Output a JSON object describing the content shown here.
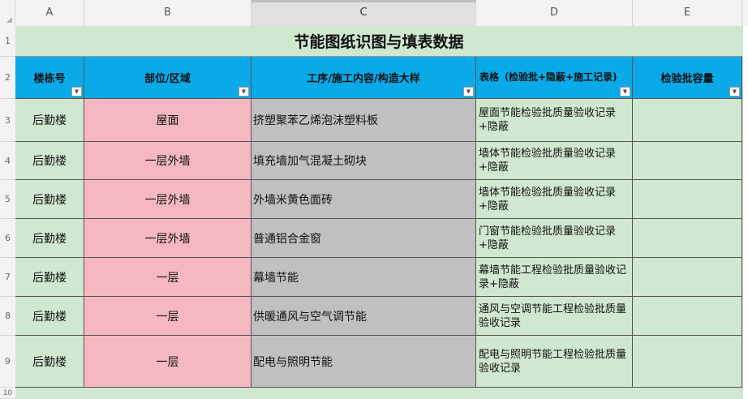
{
  "column_headers": [
    "A",
    "B",
    "C",
    "D",
    "E"
  ],
  "row_numbers": [
    "1",
    "2",
    "3",
    "4",
    "5",
    "6",
    "7",
    "8",
    "9",
    "10"
  ],
  "title": "节能图纸识图与填表数据",
  "headers": {
    "building": "楼栋号",
    "location": "部位/区域",
    "process": "工序/施工内容/构造大样",
    "form": "表格（检验批+隐蔽+施工记录)",
    "capacity": "检验批容量"
  },
  "filter_icon": "chevron-down-icon",
  "rows": [
    {
      "building": "后勤楼",
      "location": "屋面",
      "process": "挤塑聚苯乙烯泡沫塑料板",
      "form": "屋面节能检验批质量验收记录+隐蔽",
      "capacity": ""
    },
    {
      "building": "后勤楼",
      "location": "一层外墙",
      "process": "填充墙加气混凝土砌块",
      "form": "墙体节能检验批质量验收记录+隐蔽",
      "capacity": ""
    },
    {
      "building": "后勤楼",
      "location": "一层外墙",
      "process": "外墙米黄色面砖",
      "form": "墙体节能检验批质量验收记录+隐蔽",
      "capacity": ""
    },
    {
      "building": "后勤楼",
      "location": "一层外墙",
      "process": "普通铝合金窗",
      "form": "门窗节能检验批质量验收记录+隐蔽",
      "capacity": ""
    },
    {
      "building": "后勤楼",
      "location": "一层",
      "process": "幕墙节能",
      "form": "幕墙节能工程检验批质量验收记录+隐蔽",
      "capacity": ""
    },
    {
      "building": "后勤楼",
      "location": "一层",
      "process": "供暖通风与空气调节能",
      "form": "通风与空调节能工程检验批质量验收记录",
      "capacity": ""
    },
    {
      "building": "后勤楼",
      "location": "一层",
      "process": "配电与照明节能",
      "form": "配电与照明节能工程检验批质量验收记录",
      "capacity": ""
    }
  ],
  "colors": {
    "title_bg": "#cfe8cf",
    "header_bg": "#0aa9e8",
    "location_bg": "#f5b8c0",
    "process_bg": "#c0c0c0",
    "green_cell": "#cfe8cf"
  }
}
